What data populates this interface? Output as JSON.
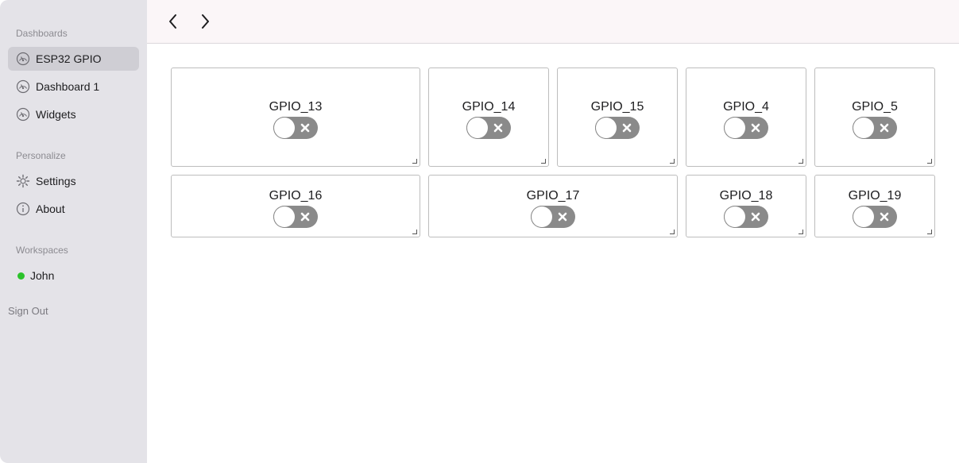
{
  "sidebar": {
    "dashboards_label": "Dashboards",
    "dashboards": [
      {
        "label": "ESP32 GPIO",
        "icon": "gauge-icon",
        "active": true
      },
      {
        "label": "Dashboard 1",
        "icon": "gauge-icon",
        "active": false
      },
      {
        "label": "Widgets",
        "icon": "gauge-icon",
        "active": false
      }
    ],
    "personalize_label": "Personalize",
    "personalize": [
      {
        "label": "Settings",
        "icon": "gear-icon"
      },
      {
        "label": "About",
        "icon": "info-icon"
      }
    ],
    "workspaces_label": "Workspaces",
    "workspaces": [
      {
        "label": "John",
        "status_color": "#2bc22b"
      }
    ],
    "sign_out": "Sign Out"
  },
  "toolbar": {
    "back_icon": "chevron-left-icon",
    "forward_icon": "chevron-right-icon"
  },
  "widgets": [
    {
      "label": "GPIO_13",
      "on": false
    },
    {
      "label": "GPIO_14",
      "on": false
    },
    {
      "label": "GPIO_15",
      "on": false
    },
    {
      "label": "GPIO_4",
      "on": false
    },
    {
      "label": "GPIO_5",
      "on": false
    },
    {
      "label": "GPIO_16",
      "on": false
    },
    {
      "label": "GPIO_17",
      "on": false
    },
    {
      "label": "GPIO_18",
      "on": false
    },
    {
      "label": "GPIO_19",
      "on": false
    }
  ],
  "colors": {
    "sidebar_bg": "#e4e3e8",
    "active_item_bg": "#cfced4",
    "toggle_off": "#8a8a8a",
    "online": "#2bc22b"
  }
}
